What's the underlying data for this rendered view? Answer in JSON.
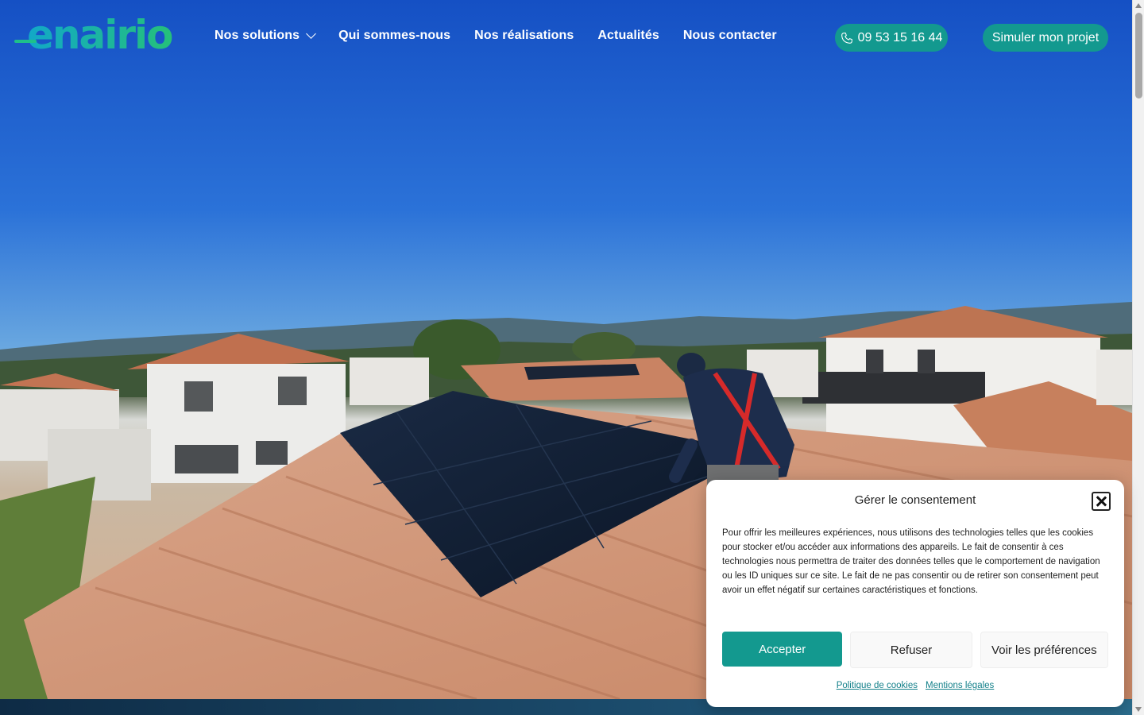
{
  "brand": {
    "logo_text": "enairio",
    "accent": "#13998f"
  },
  "nav": {
    "items": [
      {
        "label": "Nos solutions",
        "has_dropdown": true
      },
      {
        "label": "Qui sommes-nous"
      },
      {
        "label": "Nos réalisations"
      },
      {
        "label": "Actualités"
      },
      {
        "label": "Nous contacter"
      }
    ]
  },
  "header": {
    "phone_label": "09 53 15 16 44",
    "phone_icon": "phone-icon",
    "cta_label": "Simuler mon projet"
  },
  "consent": {
    "title": "Gérer le consentement",
    "body": "Pour offrir les meilleures expériences, nous utilisons des technologies telles que les cookies pour stocker et/ou accéder aux informations des appareils. Le fait de consentir à ces technologies nous permettra de traiter des données telles que le comportement de navigation ou les ID uniques sur ce site. Le fait de ne pas consentir ou de retirer son consentement peut avoir un effet négatif sur certaines caractéristiques et fonctions.",
    "accept_label": "Accepter",
    "refuse_label": "Refuser",
    "prefs_label": "Voir les préférences",
    "cookie_policy_label": "Politique de cookies",
    "legal_label": "Mentions légales"
  }
}
